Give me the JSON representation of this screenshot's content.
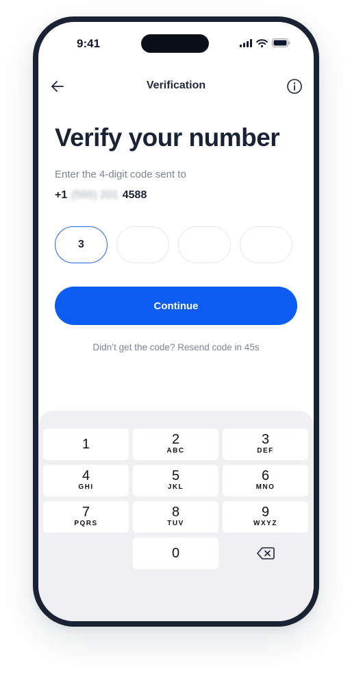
{
  "status_bar": {
    "time": "9:41"
  },
  "nav": {
    "title": "Verification",
    "back_icon": "arrow-left-icon",
    "info_icon": "info-icon"
  },
  "content": {
    "heading": "Verify your number",
    "subtext": "Enter the 4-digit code sent to",
    "phone_prefix": "+1",
    "phone_masked": "(555) 201",
    "phone_suffix": "4588",
    "code_digits": [
      "3",
      "",
      "",
      ""
    ],
    "continue_label": "Continue",
    "resend_text": "Didn’t get the code? Resend code in 45s"
  },
  "keypad": {
    "keys": [
      {
        "num": "1",
        "letters": ""
      },
      {
        "num": "2",
        "letters": "ABC"
      },
      {
        "num": "3",
        "letters": "DEF"
      },
      {
        "num": "4",
        "letters": "GHI"
      },
      {
        "num": "5",
        "letters": "JKL"
      },
      {
        "num": "6",
        "letters": "MNO"
      },
      {
        "num": "7",
        "letters": "PQRS"
      },
      {
        "num": "8",
        "letters": "TUV"
      },
      {
        "num": "9",
        "letters": "WXYZ"
      },
      {
        "num": "0",
        "letters": ""
      }
    ],
    "delete_icon": "backspace-icon"
  },
  "colors": {
    "accent": "#0b5cf0",
    "frame": "#1a2333",
    "keypad_bg": "#f0f0f2"
  }
}
